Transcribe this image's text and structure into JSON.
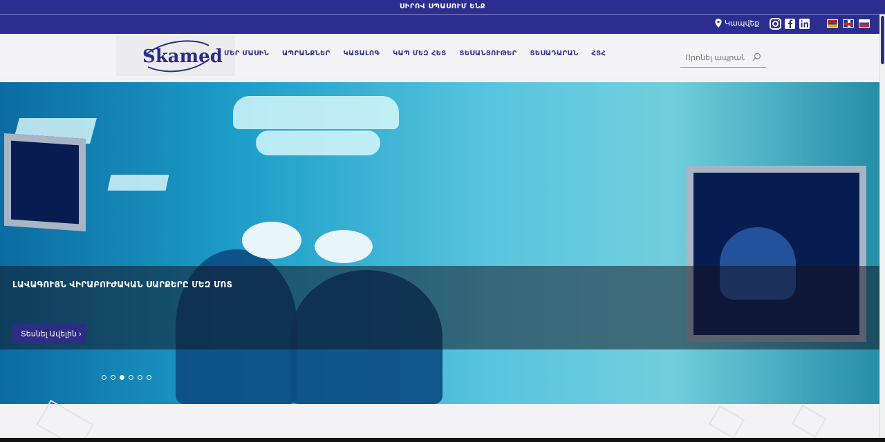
{
  "announcement": "ՍԻՐՈՎ ՍՊԱՍՈՒՄ ԵՆՔ",
  "topbar": {
    "contact_label": "Կապվեք",
    "social": [
      "instagram-icon",
      "facebook-icon",
      "linkedin-icon"
    ],
    "languages": [
      "Armenian",
      "English",
      "Russian"
    ]
  },
  "header": {
    "logo": "Skamed",
    "nav": [
      {
        "label": "ՄԵՐ ՄԱՍԻՆ"
      },
      {
        "label": "ԱՊՐԱՆՔՆԵՐ"
      },
      {
        "label": "ԿԱՏԱԼՈԳ"
      },
      {
        "label": "ԿԱՊ ՄԵԶ ՀԵՏ"
      },
      {
        "label": "ՏԵՍԱՆՅՈՒԹԵՐ"
      },
      {
        "label": "ՏԵՍԱԴԱՐԱՆ"
      },
      {
        "label": "ՀՏՀ"
      }
    ],
    "search_placeholder": "Որոնել ապրանք..."
  },
  "hero": {
    "title": "ԼԱՎԱԳՈՒՅՆ ՎԻՐԱԲՈՒԺԱԿԱՆ ՍԱՐՔԵՐԸ ՄԵԶ ՄՈՏ",
    "button_label": "Տեսնել Ավելին  ›",
    "slides": 6,
    "active_slide": 3
  },
  "colors": {
    "brand": "#2b2e8f",
    "hero_overlay": "#141420"
  }
}
